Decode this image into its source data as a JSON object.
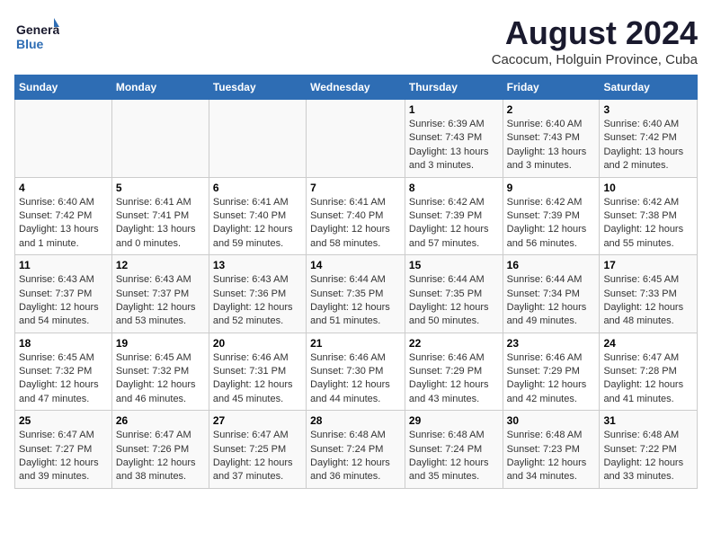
{
  "logo": {
    "line1": "General",
    "line2": "Blue"
  },
  "title": "August 2024",
  "subtitle": "Cacocum, Holguin Province, Cuba",
  "days_header": [
    "Sunday",
    "Monday",
    "Tuesday",
    "Wednesday",
    "Thursday",
    "Friday",
    "Saturday"
  ],
  "weeks": [
    [
      {
        "day": "",
        "info": ""
      },
      {
        "day": "",
        "info": ""
      },
      {
        "day": "",
        "info": ""
      },
      {
        "day": "",
        "info": ""
      },
      {
        "day": "1",
        "info": "Sunrise: 6:39 AM\nSunset: 7:43 PM\nDaylight: 13 hours\nand 3 minutes."
      },
      {
        "day": "2",
        "info": "Sunrise: 6:40 AM\nSunset: 7:43 PM\nDaylight: 13 hours\nand 3 minutes."
      },
      {
        "day": "3",
        "info": "Sunrise: 6:40 AM\nSunset: 7:42 PM\nDaylight: 13 hours\nand 2 minutes."
      }
    ],
    [
      {
        "day": "4",
        "info": "Sunrise: 6:40 AM\nSunset: 7:42 PM\nDaylight: 13 hours\nand 1 minute."
      },
      {
        "day": "5",
        "info": "Sunrise: 6:41 AM\nSunset: 7:41 PM\nDaylight: 13 hours\nand 0 minutes."
      },
      {
        "day": "6",
        "info": "Sunrise: 6:41 AM\nSunset: 7:40 PM\nDaylight: 12 hours\nand 59 minutes."
      },
      {
        "day": "7",
        "info": "Sunrise: 6:41 AM\nSunset: 7:40 PM\nDaylight: 12 hours\nand 58 minutes."
      },
      {
        "day": "8",
        "info": "Sunrise: 6:42 AM\nSunset: 7:39 PM\nDaylight: 12 hours\nand 57 minutes."
      },
      {
        "day": "9",
        "info": "Sunrise: 6:42 AM\nSunset: 7:39 PM\nDaylight: 12 hours\nand 56 minutes."
      },
      {
        "day": "10",
        "info": "Sunrise: 6:42 AM\nSunset: 7:38 PM\nDaylight: 12 hours\nand 55 minutes."
      }
    ],
    [
      {
        "day": "11",
        "info": "Sunrise: 6:43 AM\nSunset: 7:37 PM\nDaylight: 12 hours\nand 54 minutes."
      },
      {
        "day": "12",
        "info": "Sunrise: 6:43 AM\nSunset: 7:37 PM\nDaylight: 12 hours\nand 53 minutes."
      },
      {
        "day": "13",
        "info": "Sunrise: 6:43 AM\nSunset: 7:36 PM\nDaylight: 12 hours\nand 52 minutes."
      },
      {
        "day": "14",
        "info": "Sunrise: 6:44 AM\nSunset: 7:35 PM\nDaylight: 12 hours\nand 51 minutes."
      },
      {
        "day": "15",
        "info": "Sunrise: 6:44 AM\nSunset: 7:35 PM\nDaylight: 12 hours\nand 50 minutes."
      },
      {
        "day": "16",
        "info": "Sunrise: 6:44 AM\nSunset: 7:34 PM\nDaylight: 12 hours\nand 49 minutes."
      },
      {
        "day": "17",
        "info": "Sunrise: 6:45 AM\nSunset: 7:33 PM\nDaylight: 12 hours\nand 48 minutes."
      }
    ],
    [
      {
        "day": "18",
        "info": "Sunrise: 6:45 AM\nSunset: 7:32 PM\nDaylight: 12 hours\nand 47 minutes."
      },
      {
        "day": "19",
        "info": "Sunrise: 6:45 AM\nSunset: 7:32 PM\nDaylight: 12 hours\nand 46 minutes."
      },
      {
        "day": "20",
        "info": "Sunrise: 6:46 AM\nSunset: 7:31 PM\nDaylight: 12 hours\nand 45 minutes."
      },
      {
        "day": "21",
        "info": "Sunrise: 6:46 AM\nSunset: 7:30 PM\nDaylight: 12 hours\nand 44 minutes."
      },
      {
        "day": "22",
        "info": "Sunrise: 6:46 AM\nSunset: 7:29 PM\nDaylight: 12 hours\nand 43 minutes."
      },
      {
        "day": "23",
        "info": "Sunrise: 6:46 AM\nSunset: 7:29 PM\nDaylight: 12 hours\nand 42 minutes."
      },
      {
        "day": "24",
        "info": "Sunrise: 6:47 AM\nSunset: 7:28 PM\nDaylight: 12 hours\nand 41 minutes."
      }
    ],
    [
      {
        "day": "25",
        "info": "Sunrise: 6:47 AM\nSunset: 7:27 PM\nDaylight: 12 hours\nand 39 minutes."
      },
      {
        "day": "26",
        "info": "Sunrise: 6:47 AM\nSunset: 7:26 PM\nDaylight: 12 hours\nand 38 minutes."
      },
      {
        "day": "27",
        "info": "Sunrise: 6:47 AM\nSunset: 7:25 PM\nDaylight: 12 hours\nand 37 minutes."
      },
      {
        "day": "28",
        "info": "Sunrise: 6:48 AM\nSunset: 7:24 PM\nDaylight: 12 hours\nand 36 minutes."
      },
      {
        "day": "29",
        "info": "Sunrise: 6:48 AM\nSunset: 7:24 PM\nDaylight: 12 hours\nand 35 minutes."
      },
      {
        "day": "30",
        "info": "Sunrise: 6:48 AM\nSunset: 7:23 PM\nDaylight: 12 hours\nand 34 minutes."
      },
      {
        "day": "31",
        "info": "Sunrise: 6:48 AM\nSunset: 7:22 PM\nDaylight: 12 hours\nand 33 minutes."
      }
    ]
  ]
}
